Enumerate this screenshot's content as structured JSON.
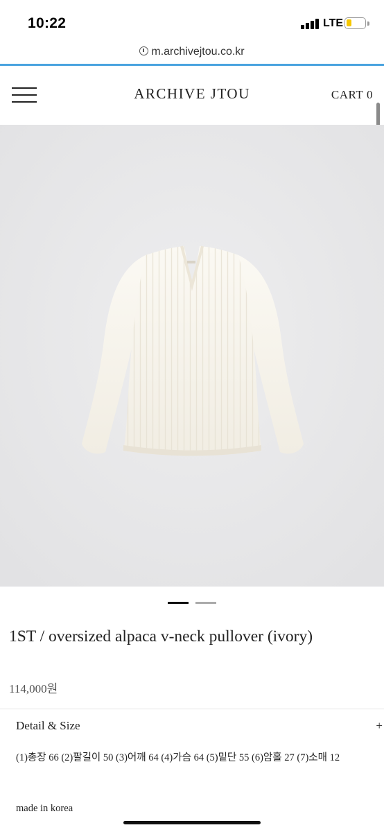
{
  "status_bar": {
    "time": "10:22",
    "network": "LTE",
    "battery_level": 0.2,
    "battery_color": "#f6c700"
  },
  "browser": {
    "url": "m.archivejtou.co.kr",
    "url_icon": "info-icon"
  },
  "header": {
    "menu_icon": "hamburger-menu-icon",
    "brand": "ARCHIVE JTOU",
    "cart_label": "CART",
    "cart_count": "0"
  },
  "gallery": {
    "image_subject": "ivory v-neck knit pullover on gray background",
    "total_slides": 2,
    "active_slide": 1,
    "active_color": "#111111",
    "inactive_color": "#aaaaaa"
  },
  "product": {
    "title": "1ST / oversized alpaca v-neck pullover (ivory)",
    "price": "114,000원"
  },
  "detail": {
    "section_title": "Detail & Size",
    "toggle": "+",
    "size_info": "(1)총장 66 (2)팔길이 50 (3)어깨 64 (4)가슴 64 (5)밑단 55 (6)암홀 27 (7)소매 12",
    "origin": "made in korea"
  }
}
